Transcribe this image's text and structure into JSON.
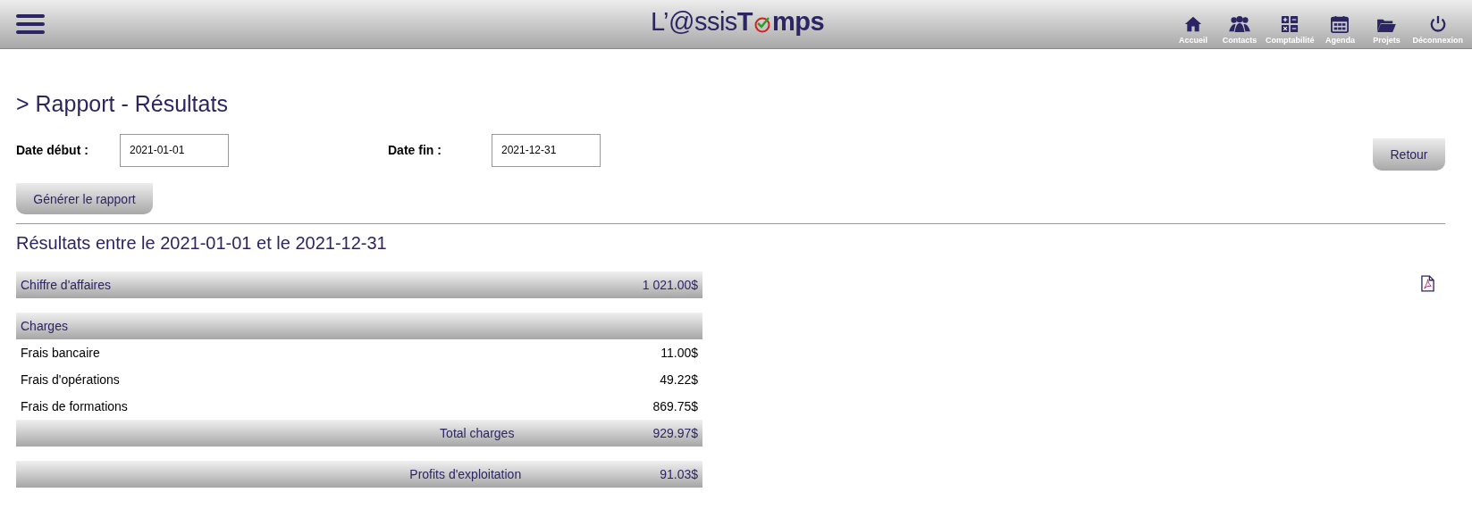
{
  "header": {
    "logo": {
      "light": "L’@ssis",
      "bold_start": "T",
      "bold_end": "mps"
    },
    "nav": [
      {
        "label": "Accueil"
      },
      {
        "label": "Contacts"
      },
      {
        "label": "Comptabilité"
      },
      {
        "label": "Agenda"
      },
      {
        "label": "Projets"
      },
      {
        "label": "Déconnexion"
      }
    ]
  },
  "page_title": "> Rapport - Résultats",
  "filters": [
    {
      "label": "Date début :",
      "value": "2021-01-01"
    },
    {
      "label": "Date fin :",
      "value": "2021-12-31"
    }
  ],
  "back_button": "Retour",
  "generate_button": "Générer le rapport",
  "results_title": "Résultats entre le 2021-01-01 et le 2021-12-31",
  "report": {
    "revenue": {
      "label": "Chiffre d'affaires",
      "amount": "1 021.00$"
    },
    "charges": {
      "title": "Charges",
      "items": [
        {
          "label": "Frais bancaire",
          "amount": "11.00$"
        },
        {
          "label": "Frais d'opérations",
          "amount": "49.22$"
        },
        {
          "label": "Frais de formations",
          "amount": "869.75$"
        }
      ],
      "total": {
        "label": "Total charges",
        "amount": "929.97$"
      }
    },
    "profit": {
      "label": "Profits d'exploitation",
      "amount": "91.03$"
    }
  }
}
